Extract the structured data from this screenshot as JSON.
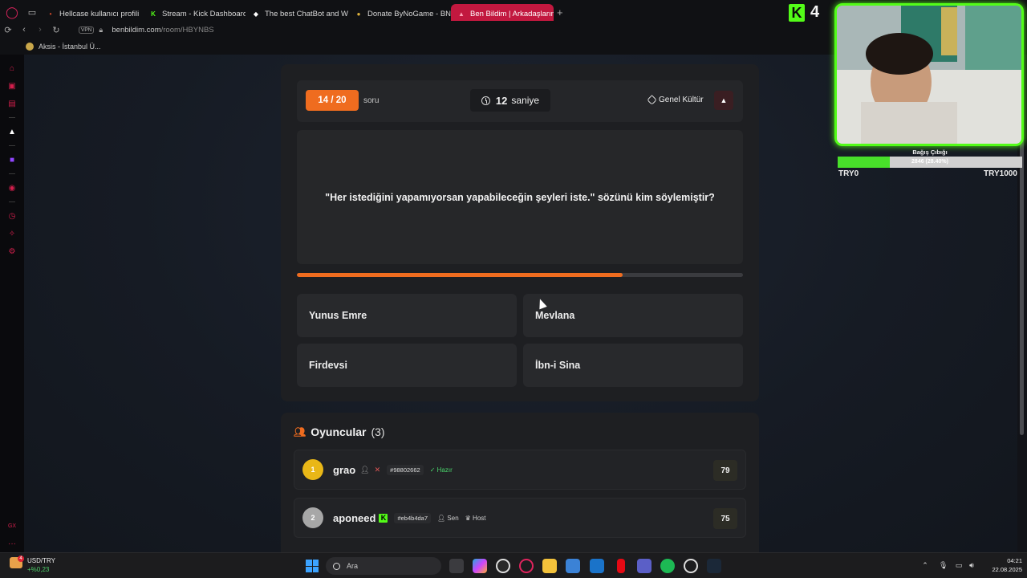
{
  "browser": {
    "tabs": [
      {
        "label": "Hellcase kullanıcı profili",
        "fav_color": "#d84c2a",
        "fav_glyph": "•"
      },
      {
        "label": "Stream - Kick Dashboard",
        "fav_color": "#53fc18",
        "fav_glyph": "K"
      },
      {
        "label": "The best ChatBot and We",
        "fav_color": "#ffffff",
        "fav_glyph": "◆"
      },
      {
        "label": "Donate ByNoGame - BNG",
        "fav_color": "#e0b33c",
        "fav_glyph": "●"
      },
      {
        "label": "Ben Bildim | Arkadaşlarını",
        "fav_color": "#ff9fb4",
        "fav_glyph": "▲",
        "active": true
      }
    ],
    "vpn_label": "VPN",
    "url_host": "benbildim.com",
    "url_path": "/room/HBYNBS",
    "bookmark": "Aksis - İstanbul Ü..."
  },
  "quiz": {
    "counter": "14 / 20",
    "counter_unit": "soru",
    "timer_value": "12",
    "timer_unit": "saniye",
    "category": "Genel Kültür",
    "question": "\"Her istediğini yapamıyorsan yapabileceğin şeyleri iste.\" sözünü kim söylemiştir?",
    "progress": 0.73,
    "answers": [
      "Yunus Emre",
      "Mevlana",
      "Firdevsi",
      "İbn-i Sina"
    ],
    "accent": "#ef6c1f"
  },
  "players": {
    "title": "Oyuncular",
    "count": "(3)",
    "list": [
      {
        "rank": "1",
        "name": "grao",
        "hash": "#98802662",
        "status": "Hazır",
        "score": "79",
        "rank_color": "#e9b717"
      },
      {
        "rank": "2",
        "name": "aponeed",
        "hash": "#eb4b4da7",
        "you": "Sen",
        "role": "Host",
        "score": "75",
        "rank_color": "#a7a7a7"
      }
    ]
  },
  "stream_overlay": {
    "viewer_count": "4",
    "donation_title": "Bağış Çıbığı",
    "donation_text": "2846 (28.40%)",
    "donation_progress": 0.284,
    "donation_min": "TRY0",
    "donation_max": "TRY1000"
  },
  "taskbar": {
    "fx_badge": "4",
    "fx_pair": "USD/TRY",
    "fx_change": "+%0,23",
    "search_placeholder": "Ara",
    "time": "04:21",
    "date": "22.08.2025"
  }
}
